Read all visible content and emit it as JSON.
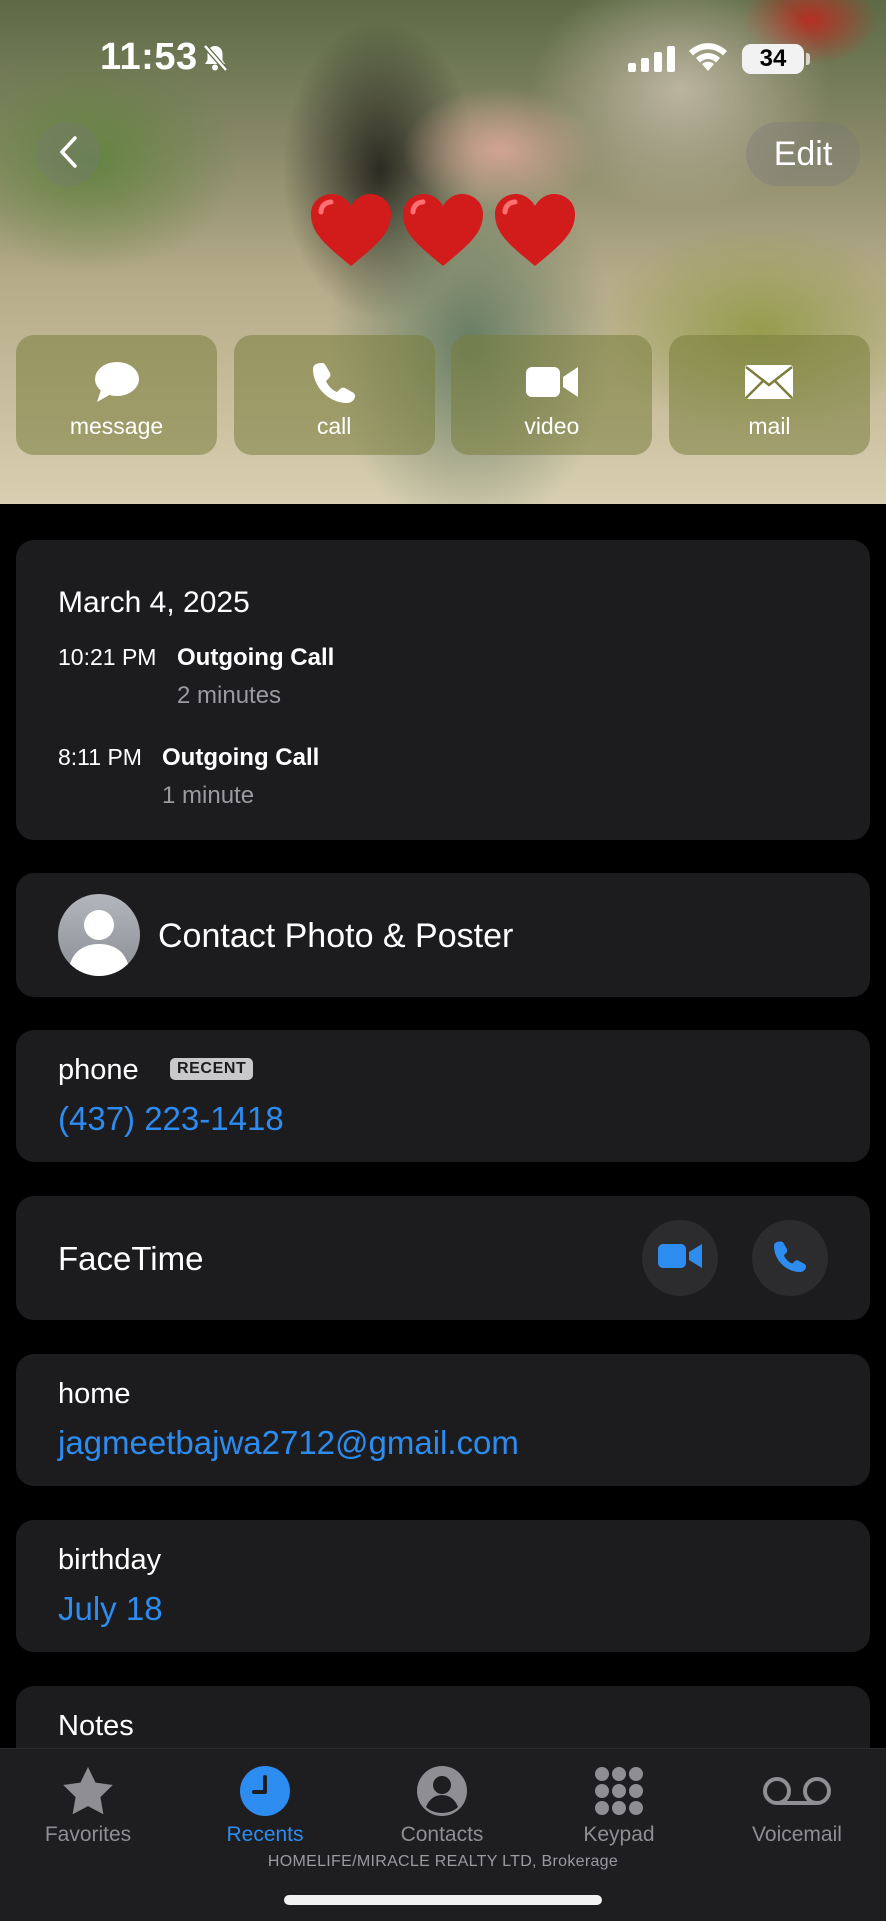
{
  "status_bar": {
    "time": "11:53",
    "battery": "34"
  },
  "nav": {
    "edit_label": "Edit"
  },
  "hearts": [
    "❤️",
    "❤️",
    "❤️"
  ],
  "actions": [
    {
      "label": "message",
      "icon": "message-icon"
    },
    {
      "label": "call",
      "icon": "phone-icon"
    },
    {
      "label": "video",
      "icon": "video-icon"
    },
    {
      "label": "mail",
      "icon": "mail-icon"
    }
  ],
  "calls": {
    "date": "March 4, 2025",
    "entries": [
      {
        "time": "10:21 PM",
        "type": "Outgoing Call",
        "duration": "2 minutes"
      },
      {
        "time": "8:11 PM",
        "type": "Outgoing Call",
        "duration": "1 minute"
      }
    ]
  },
  "contact_photo": {
    "label": "Contact Photo & Poster"
  },
  "phone": {
    "label": "phone",
    "badge": "RECENT",
    "value": "(437) 223-1418"
  },
  "facetime": {
    "label": "FaceTime"
  },
  "email": {
    "label": "home",
    "value": "jagmeetbajwa2712@gmail.com"
  },
  "birthday": {
    "label": "birthday",
    "value": "July 18"
  },
  "notes": {
    "label": "Notes"
  },
  "tabs": [
    {
      "label": "Favorites",
      "icon": "star-icon",
      "active": false
    },
    {
      "label": "Recents",
      "icon": "clock-icon",
      "active": true
    },
    {
      "label": "Contacts",
      "icon": "person-icon",
      "active": false
    },
    {
      "label": "Keypad",
      "icon": "keypad-icon",
      "active": false
    },
    {
      "label": "Voicemail",
      "icon": "voicemail-icon",
      "active": false
    }
  ],
  "footer": "HOMELIFE/MIRACLE REALTY LTD, Brokerage",
  "colors": {
    "accent": "#2d8cf0",
    "card": "#1c1c1e",
    "background": "#000000"
  }
}
